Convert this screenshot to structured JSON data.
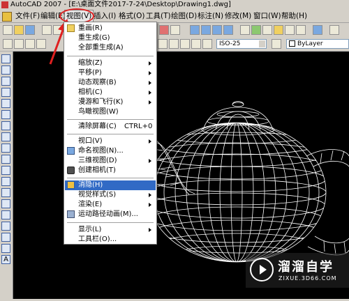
{
  "window": {
    "title": "AutoCAD 2007 - [E:\\桌面文件2017-7-24\\Desktop\\Drawing1.dwg]"
  },
  "menubar": {
    "items": [
      {
        "label": "文件(F)"
      },
      {
        "label": "编辑(E)"
      },
      {
        "label": "视图(V)"
      },
      {
        "label": "插入(I)"
      },
      {
        "label": "格式(O)"
      },
      {
        "label": "工具(T)"
      },
      {
        "label": "绘图(D)"
      },
      {
        "label": "标注(N)"
      },
      {
        "label": "修改(M)"
      },
      {
        "label": "窗口(W)"
      },
      {
        "label": "帮助(H)"
      }
    ],
    "active_index": 2
  },
  "toolbar2": {
    "dimstyle": "ISO-25",
    "layer": "ByLayer"
  },
  "view_menu": {
    "items": [
      {
        "label": "重画(R)",
        "has_sub": false
      },
      {
        "label": "重生成(G)",
        "has_sub": false
      },
      {
        "label": "全部重生成(A)",
        "has_sub": false
      },
      {
        "label": "缩放(Z)",
        "has_sub": true
      },
      {
        "label": "平移(P)",
        "has_sub": true
      },
      {
        "label": "动态观察(B)",
        "has_sub": true
      },
      {
        "label": "相机(C)",
        "has_sub": true
      },
      {
        "label": "漫游和飞行(K)",
        "has_sub": true
      },
      {
        "label": "鸟瞰视图(W)",
        "has_sub": false
      },
      {
        "label": "清除屏幕(C)",
        "shortcut": "CTRL+0",
        "has_sub": false
      },
      {
        "label": "视口(V)",
        "has_sub": true
      },
      {
        "label": "命名视图(N)...",
        "has_sub": false
      },
      {
        "label": "三维视图(D)",
        "has_sub": true
      },
      {
        "label": "创建相机(T)",
        "has_sub": false
      },
      {
        "label": "消隐(H)",
        "has_sub": false,
        "highlighted": true
      },
      {
        "label": "视觉样式(S)",
        "has_sub": true
      },
      {
        "label": "渲染(E)",
        "has_sub": true
      },
      {
        "label": "运动路径动画(M)...",
        "has_sub": false
      },
      {
        "label": "显示(L)",
        "has_sub": true
      },
      {
        "label": "工具栏(O)...",
        "has_sub": false
      }
    ]
  },
  "watermark": {
    "title": "溜溜自学",
    "subtitle": "ZIXUE.3D66.COM"
  },
  "colors": {
    "menu_highlight": "#316ac5",
    "annotation_red": "#e02020",
    "canvas": "#000000"
  }
}
